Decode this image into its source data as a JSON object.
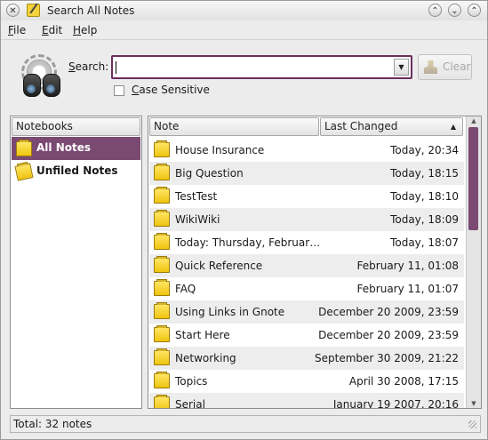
{
  "window": {
    "title": "Search All Notes"
  },
  "menubar": {
    "items": [
      {
        "underline": "F",
        "rest": "ile"
      },
      {
        "underline": "E",
        "rest": "dit"
      },
      {
        "underline": "H",
        "rest": "elp"
      }
    ]
  },
  "search": {
    "label_underline": "S",
    "label_rest": "earch:",
    "value": "",
    "clear_label": "Clear",
    "case_underline": "C",
    "case_rest": "ase Sensitive",
    "case_checked": false
  },
  "notebooks": {
    "header": "Notebooks",
    "items": [
      {
        "label": "All Notes",
        "selected": true
      },
      {
        "label": "Unfiled Notes",
        "selected": false
      }
    ]
  },
  "notes": {
    "col_note": "Note",
    "col_changed": "Last Changed",
    "rows": [
      {
        "title": "House Insurance",
        "changed": "Today, 20:34"
      },
      {
        "title": "Big Question",
        "changed": "Today, 18:15"
      },
      {
        "title": "TestTest",
        "changed": "Today, 18:10"
      },
      {
        "title": "WikiWiki",
        "changed": "Today, 18:09"
      },
      {
        "title": "Today: Thursday, Februar…",
        "changed": "Today, 18:07"
      },
      {
        "title": "Quick Reference",
        "changed": "February 11, 01:08"
      },
      {
        "title": "FAQ",
        "changed": "February 11, 01:07"
      },
      {
        "title": "Using Links in Gnote",
        "changed": "December 20 2009, 23:59"
      },
      {
        "title": "Start Here",
        "changed": "December 20 2009, 23:59"
      },
      {
        "title": "Networking",
        "changed": "September 30 2009, 21:22"
      },
      {
        "title": "Topics",
        "changed": "April 30 2008, 17:15"
      },
      {
        "title": "Serial",
        "changed": "January 19 2007, 20:16"
      }
    ]
  },
  "status": {
    "text": "Total: 32 notes"
  },
  "colors": {
    "accent": "#7b4a73",
    "note_icon": "#f0c40f"
  }
}
